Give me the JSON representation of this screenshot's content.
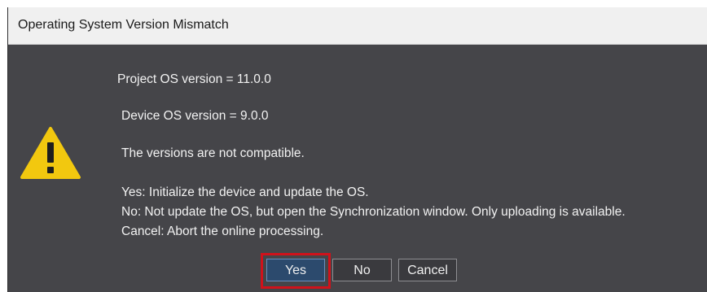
{
  "dialog": {
    "title": "Operating System Version Mismatch",
    "messages": {
      "project_os": "Project OS version = 11.0.0",
      "device_os": "Device OS version = 9.0.0",
      "not_compatible": "The versions are not compatible.",
      "yes_desc": "Yes: Initialize the device and update the OS.",
      "no_desc": "No: Not update the OS, but open the Synchronization window. Only uploading is available.",
      "cancel_desc": "Cancel: Abort the online processing."
    },
    "buttons": {
      "yes": "Yes",
      "no": "No",
      "cancel": "Cancel"
    },
    "icon": "warning-triangle-icon",
    "colors": {
      "background": "#454549",
      "warning": "#f2c80f",
      "highlight": "#d0121b"
    }
  }
}
